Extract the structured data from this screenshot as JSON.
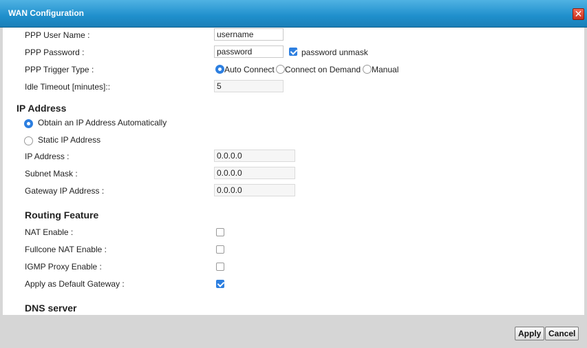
{
  "dialog": {
    "title": "WAN Configuration",
    "close_glyph": "✕"
  },
  "ppp": {
    "user_name_label": "PPP User Name :",
    "user_name_value": "username",
    "password_label": "PPP Password :",
    "password_value": "password",
    "unmask_label": "password unmask",
    "unmask_checked": true,
    "trigger_label": "PPP Trigger Type :",
    "trigger_options": [
      "Auto Connect",
      "Connect on Demand",
      "Manual"
    ],
    "trigger_selected": "Auto Connect",
    "idle_label": "Idle Timeout [minutes]::",
    "idle_value": "5"
  },
  "ip": {
    "section_title": "IP Address",
    "obtain_auto_label": "Obtain an IP Address Automatically",
    "static_label": "Static IP Address",
    "selected": "Obtain an IP Address Automatically",
    "ip_label": "IP Address :",
    "ip_value": "0.0.0.0",
    "subnet_label": "Subnet Mask :",
    "subnet_value": "0.0.0.0",
    "gateway_label": "Gateway IP Address :",
    "gateway_value": "0.0.0.0"
  },
  "routing": {
    "section_title": "Routing Feature",
    "nat_label": "NAT Enable :",
    "nat_checked": false,
    "fullcone_label": "Fullcone NAT Enable :",
    "fullcone_checked": false,
    "igmp_label": "IGMP Proxy Enable :",
    "igmp_checked": false,
    "default_gw_label": "Apply as Default Gateway :",
    "default_gw_checked": true
  },
  "dns": {
    "section_title": "DNS server"
  },
  "footer": {
    "apply_label": "Apply",
    "cancel_label": "Cancel"
  },
  "colors": {
    "titlebar": "#1f8fcc",
    "accent": "#2d7fe0",
    "close": "#d9402b"
  }
}
